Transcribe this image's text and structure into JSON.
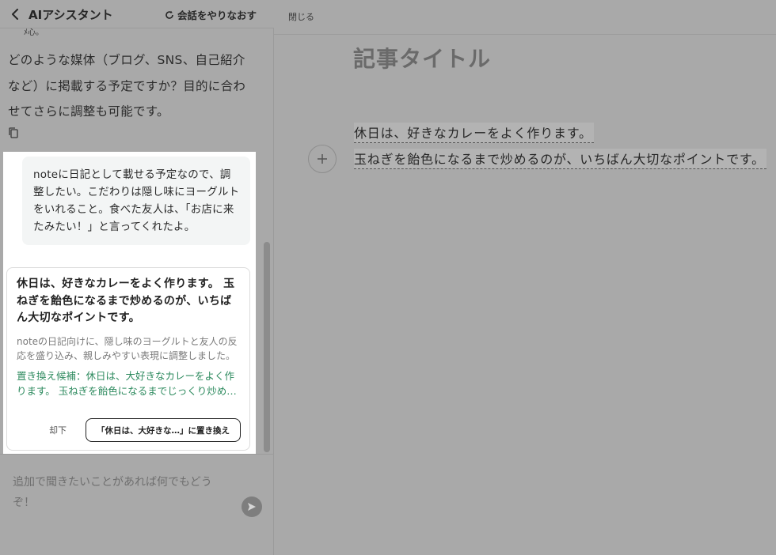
{
  "assistant": {
    "title": "AIアシスタント",
    "restart_label": "会話をやりなおす",
    "cut_text": "ﾒ心。",
    "ai_message": "どのような媒体（ブログ、SNS、自己紹介など）に掲載する予定ですか？目的に合わせてさらに調整も可能です。",
    "user_message": "noteに日記として載せる予定なので、調整したい。こだわりは隠し味にヨーグルトをいれること。食べた友人は、「お店に来たみたい！」と言ってくれたよ。",
    "suggestion": {
      "title": "休日は、好きなカレーをよく作ります。 玉ねぎを飴色になるまで炒めるのが、いちばん大切なポイントです。",
      "description": "noteの日記向けに、隠し味のヨーグルトと友人の反応を盛り込み、親しみやすい表現に調整しました。",
      "alternative": "置き換え候補：休日は、大好きなカレーをよく作ります。 玉ねぎを飴色になるまでじっくり炒め…",
      "reject_label": "却下",
      "replace_label": "「休日は、大好きな…」に置き換え"
    },
    "input_placeholder": "追加で聞きたいことがあれば何でもどうぞ！"
  },
  "editor": {
    "close_label": "閉じる",
    "article_title": "記事タイトル",
    "lines": [
      "休日は、好きなカレーをよく作ります。",
      "玉ねぎを飴色になるまで炒めるのが、いちばん大切なポイントです。"
    ]
  },
  "colors": {
    "overlay": "#a9a9a9",
    "accent_green": "#2e8b5f"
  }
}
